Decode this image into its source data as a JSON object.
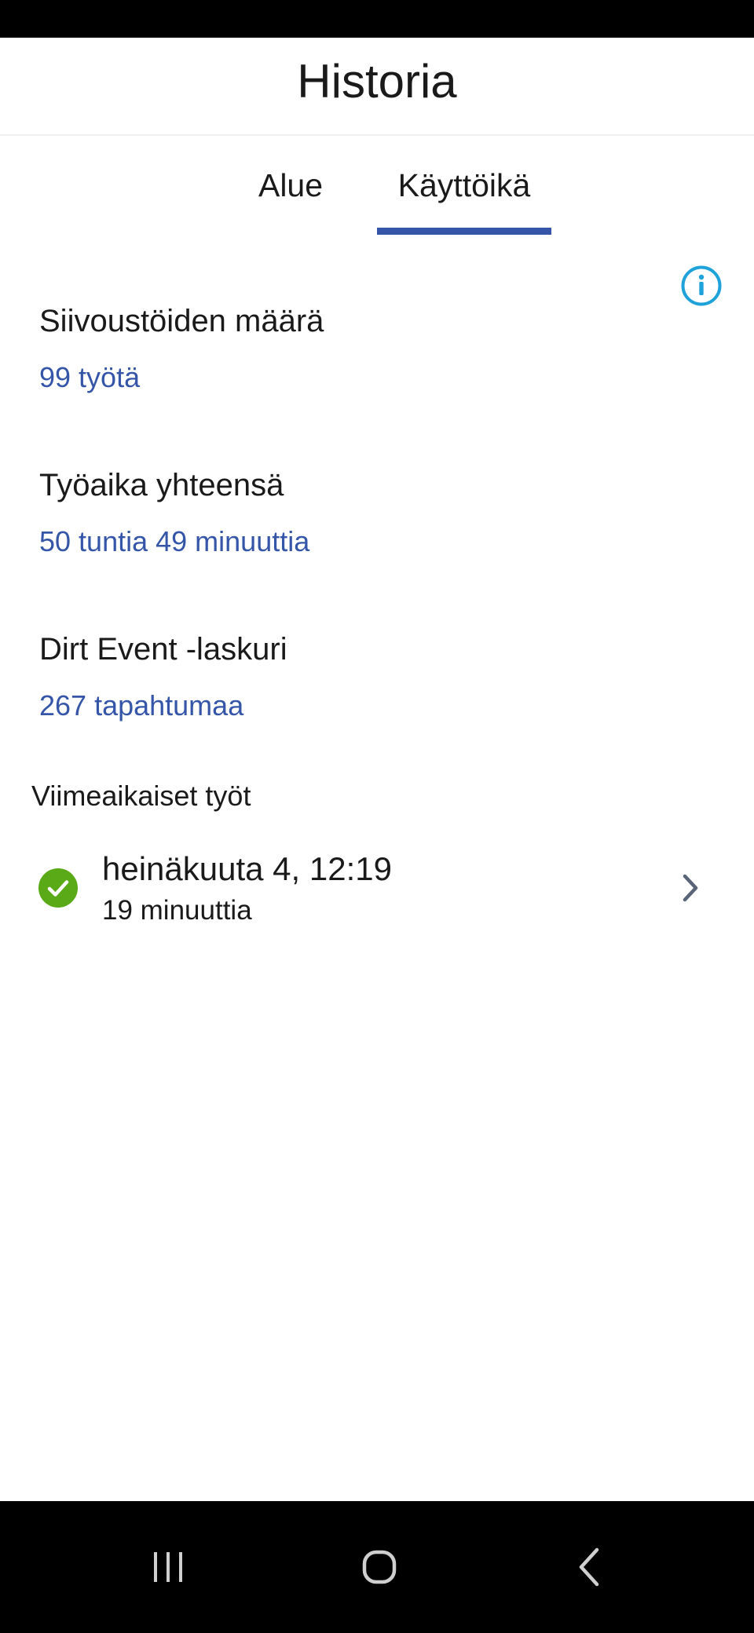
{
  "header": {
    "title": "Historia"
  },
  "tabs": [
    {
      "label": "Alue",
      "selected": false
    },
    {
      "label": "Käyttöikä",
      "selected": true
    }
  ],
  "stats": {
    "jobs": {
      "label": "Siivoustöiden määrä",
      "value": "99 työtä"
    },
    "work_time": {
      "label": "Työaika yhteensä",
      "value": "50 tuntia 49 minuuttia"
    },
    "dirt_events": {
      "label": "Dirt Event -laskuri",
      "value": "267 tapahtumaa"
    }
  },
  "recent": {
    "title": "Viimeaikaiset työt",
    "items": [
      {
        "date": "heinäkuuta 4, 12:19",
        "duration": "19 minuuttia",
        "status": "completed",
        "status_icon": "check-circle-icon"
      }
    ]
  },
  "icons": {
    "info": "info-icon",
    "chevron": "chevron-right-icon"
  },
  "colors": {
    "accent": "#3556a8",
    "info": "#1fa1d9",
    "success": "#5aaa18"
  }
}
